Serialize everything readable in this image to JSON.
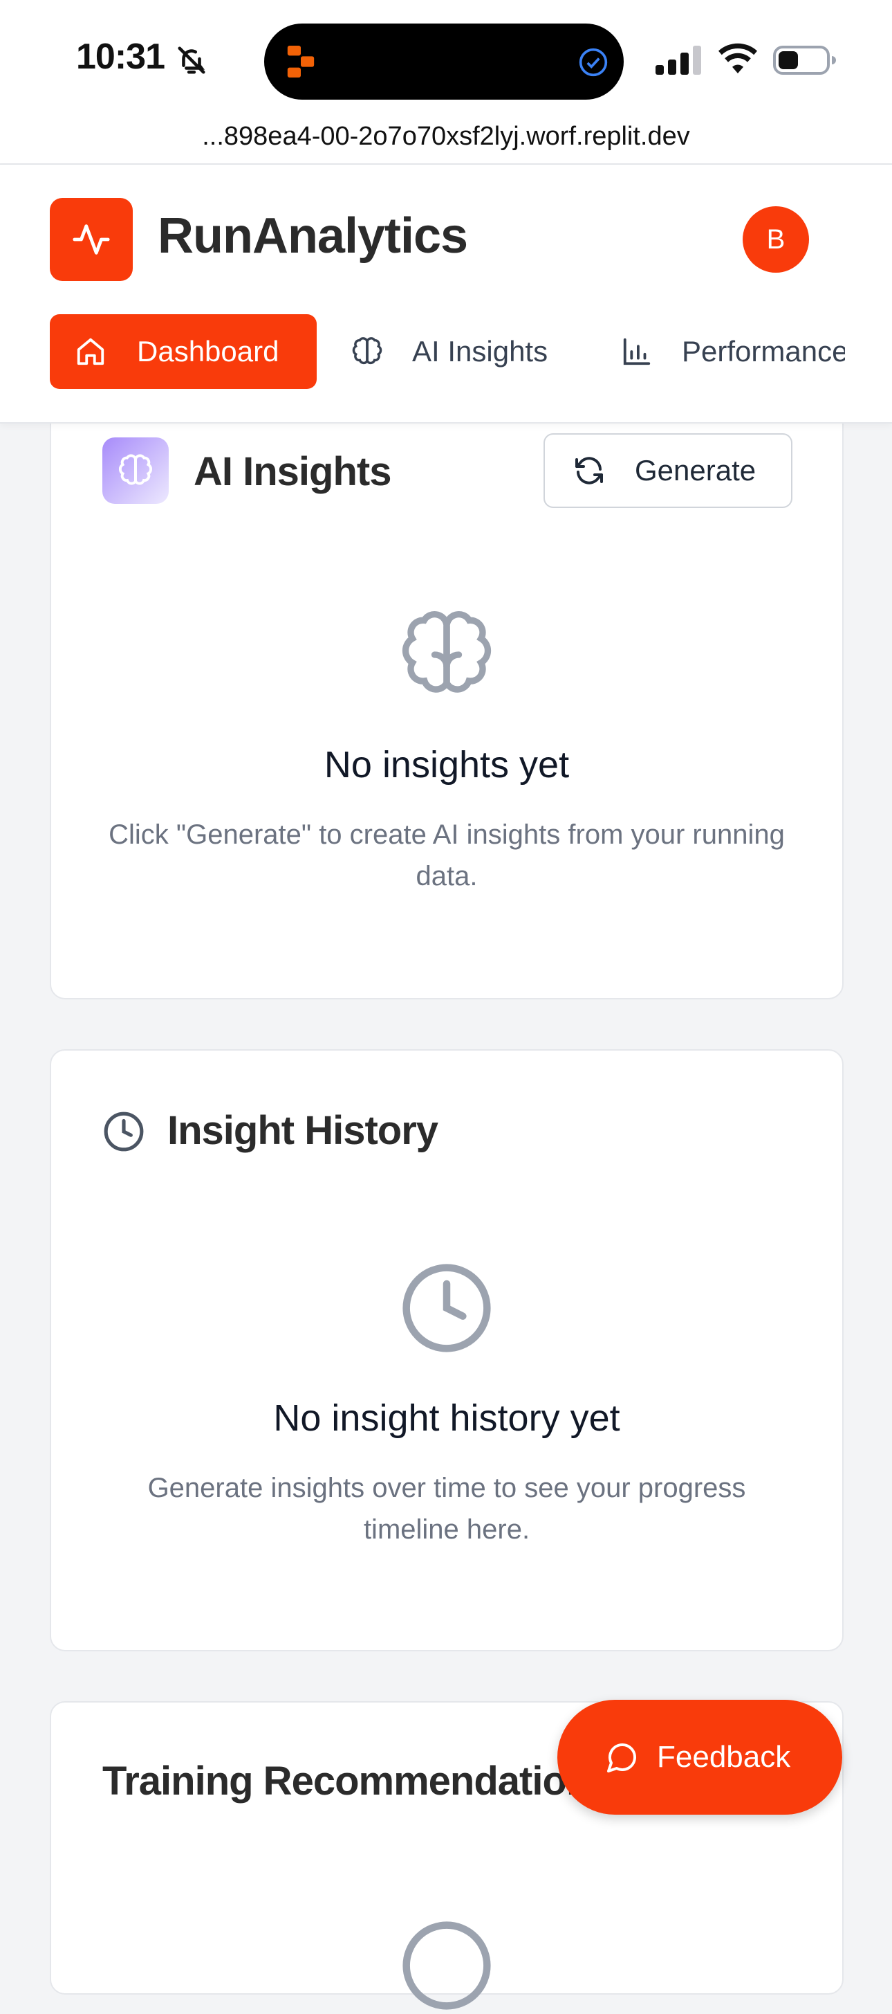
{
  "status_bar": {
    "time": "10:31"
  },
  "browser": {
    "url": "...898ea4-00-2o7o70xsf2lyj.worf.replit.dev"
  },
  "header": {
    "brand": "RunAnalytics",
    "avatar_initial": "B",
    "nav": [
      {
        "label": "Dashboard",
        "icon": "home-icon",
        "active": true
      },
      {
        "label": "AI Insights",
        "icon": "brain-icon",
        "active": false
      },
      {
        "label": "Performance",
        "icon": "bar-chart-icon",
        "active": false
      }
    ]
  },
  "ai_insights": {
    "title": "AI Insights",
    "generate_label": "Generate",
    "empty_title": "No insights yet",
    "empty_desc": "Click \"Generate\" to create AI insights from your running data."
  },
  "insight_history": {
    "title": "Insight History",
    "empty_title": "No insight history yet",
    "empty_desc": "Generate insights over time to see your progress timeline here."
  },
  "training": {
    "title": "Training Recommendations"
  },
  "feedback": {
    "label": "Feedback"
  },
  "colors": {
    "accent": "#f93b0b",
    "muted_icon": "#9ca3af",
    "purple": "#a78bfa"
  }
}
